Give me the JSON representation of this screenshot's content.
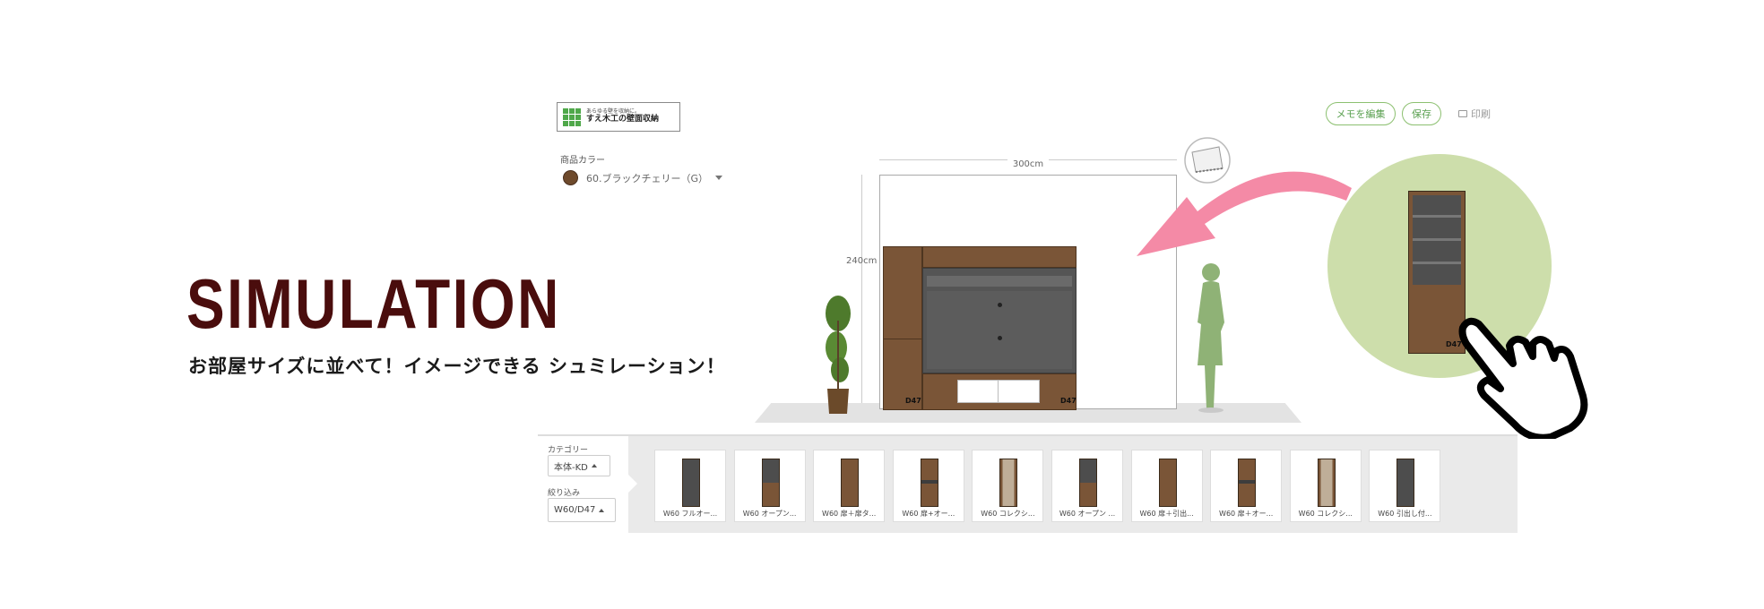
{
  "hero": {
    "title": "SIMULATION",
    "subtitle": "お部屋サイズに並べて！イメージできる シュミレーション！"
  },
  "app": {
    "logo": {
      "tagline": "あらゆる壁を収納に。",
      "name": "すえ木工の壁面収納"
    },
    "color": {
      "label": "商品カラー",
      "value": "60.ブラックチェリー（G）",
      "swatch": "#6e4a2c"
    },
    "toolbar": {
      "memo_label": "メモを編集",
      "save_label": "保存",
      "print_label": "印刷"
    },
    "canvas": {
      "width_label": "300cm",
      "height_label": "240cm",
      "depth_left": "D47",
      "depth_right": "D47",
      "depth_preview": "D47"
    }
  },
  "catalog": {
    "category_label": "カテゴリー",
    "category_value": "本体-KD",
    "filter_label": "絞り込み",
    "filter_value": "W60/D47",
    "items": [
      {
        "label": "W60 フルオー...",
        "style": "dark"
      },
      {
        "label": "W60 オープン...",
        "style": "mixed"
      },
      {
        "label": "W60 扉＋扉タ...",
        "style": "wood"
      },
      {
        "label": "W60 扉+オー...",
        "style": "wood-band"
      },
      {
        "label": "W60 コレクシ...",
        "style": "glass"
      },
      {
        "label": "W60 オープン ...",
        "style": "mixed"
      },
      {
        "label": "W60 扉＋引出...",
        "style": "wood"
      },
      {
        "label": "W60 扉＋オー...",
        "style": "wood-band"
      },
      {
        "label": "W60 コレクシ...",
        "style": "glass"
      },
      {
        "label": "W60 引出し付...",
        "style": "dark"
      }
    ]
  },
  "colors": {
    "accent_green": "#8cc070",
    "hero_title": "#4a0d0d",
    "arrow_pink": "#f48aa6",
    "circle_green": "#cddeab"
  }
}
